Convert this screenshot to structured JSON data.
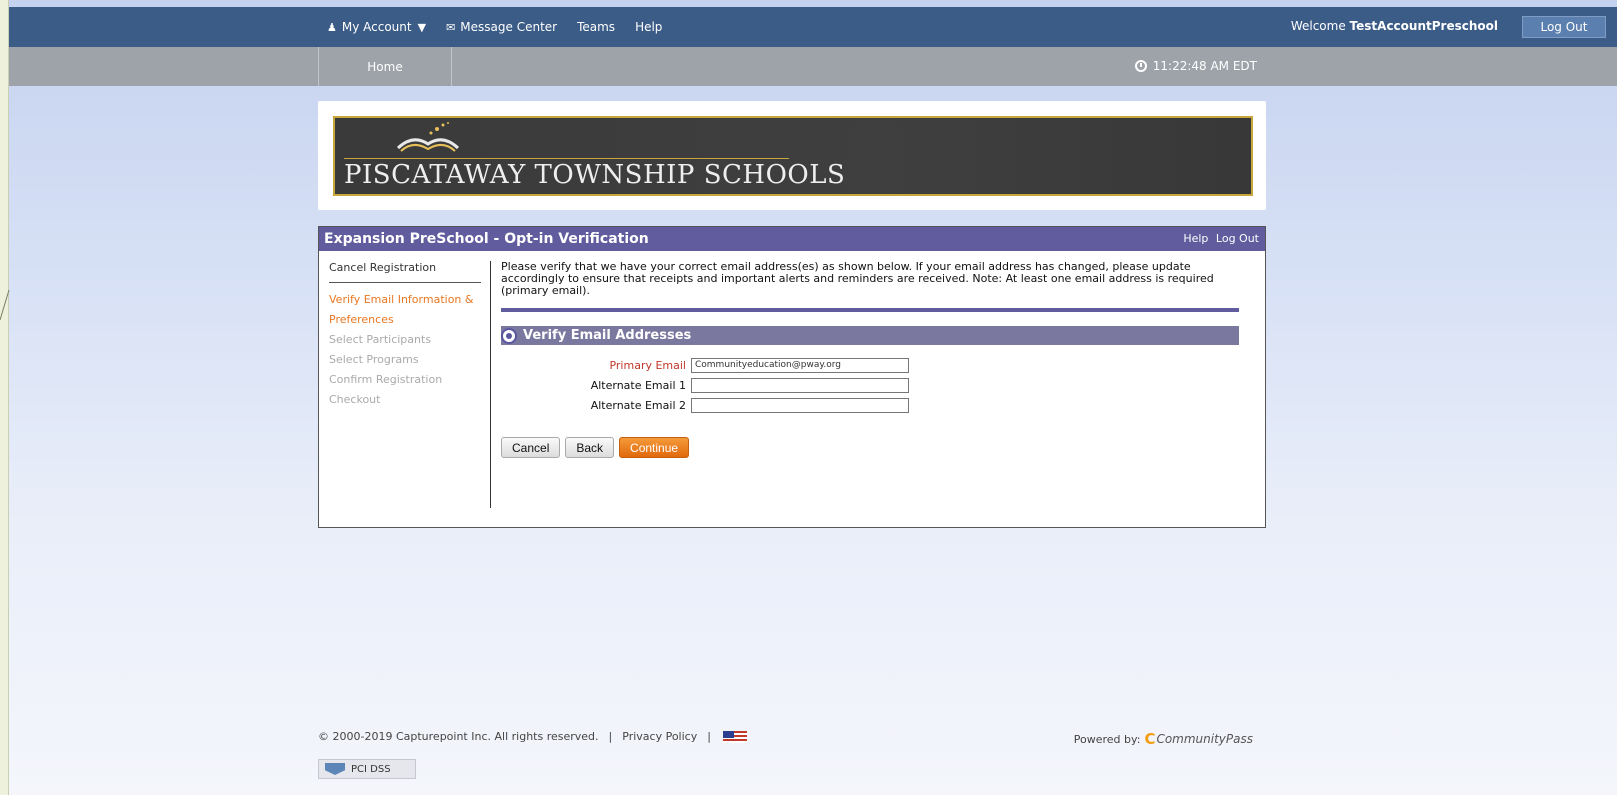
{
  "topbar": {
    "my_account": "My Account",
    "message_center": "Message Center",
    "teams": "Teams",
    "help": "Help",
    "welcome_prefix": "Welcome",
    "username": "TestAccountPreschool",
    "logout": "Log Out"
  },
  "subbar": {
    "home": "Home",
    "time": "11:22:48 AM EDT"
  },
  "banner": {
    "title": "PISCATAWAY TOWNSHIP SCHOOLS"
  },
  "card": {
    "title": "Expansion PreSchool - Opt-in Verification",
    "help": "Help",
    "logout": "Log Out"
  },
  "sidebar": {
    "cancel": "Cancel Registration",
    "steps": [
      {
        "label": "Verify Email Information & Preferences"
      },
      {
        "label": "Select Participants"
      },
      {
        "label": "Select Programs"
      },
      {
        "label": "Confirm Registration"
      },
      {
        "label": "Checkout"
      }
    ]
  },
  "content": {
    "intro": "Please verify that we have your correct email address(es) as shown below. If your email address has changed, please update accordingly to ensure that receipts and important alerts and reminders are received. Note: At least one email address is required (primary email).",
    "section_title": "Verify Email Addresses",
    "primary_label": "Primary Email",
    "primary_value": "Communityeducation@pway.org",
    "alt1_label": "Alternate Email 1",
    "alt1_value": "",
    "alt2_label": "Alternate Email 2",
    "alt2_value": "",
    "cancel_btn": "Cancel",
    "back_btn": "Back",
    "continue_btn": "Continue"
  },
  "footer": {
    "copyright": "© 2000-2019 Capturepoint Inc. All rights reserved.",
    "separator": "|",
    "privacy": "Privacy Policy",
    "powered_by": "Powered by:",
    "brand": "CommunityPass",
    "pci": "PCI DSS"
  },
  "colors": {
    "topbar": "#3b5c86",
    "subbar": "#9ea3aa",
    "card_header": "#605c9e",
    "active_step": "#e87722",
    "continue_button": "#e0690d"
  }
}
